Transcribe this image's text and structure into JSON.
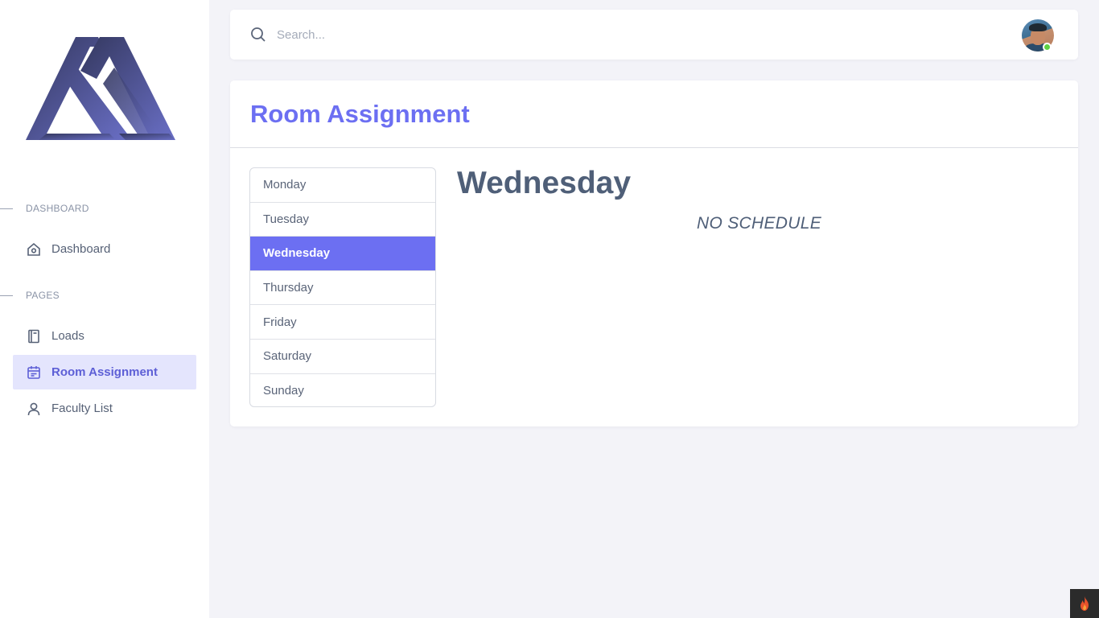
{
  "sidebar": {
    "sections": [
      {
        "title": "DASHBOARD"
      },
      {
        "title": "PAGES"
      }
    ],
    "items": [
      {
        "label": "Dashboard",
        "icon": "home-icon"
      },
      {
        "label": "Loads",
        "icon": "book-icon"
      },
      {
        "label": "Room Assignment",
        "icon": "calendar-icon",
        "active": true
      },
      {
        "label": "Faculty List",
        "icon": "user-icon"
      }
    ]
  },
  "topbar": {
    "search": {
      "placeholder": "Search...",
      "value": ""
    },
    "user": {
      "online": true
    }
  },
  "main": {
    "title": "Room Assignment",
    "days": [
      "Monday",
      "Tuesday",
      "Wednesday",
      "Thursday",
      "Friday",
      "Saturday",
      "Sunday"
    ],
    "selected_day": "Wednesday",
    "heading": "Wednesday",
    "empty_message": "NO SCHEDULE"
  },
  "colors": {
    "accent": "#6c6ff2",
    "active_bg": "#e4e5fd",
    "online": "#5fd143"
  }
}
